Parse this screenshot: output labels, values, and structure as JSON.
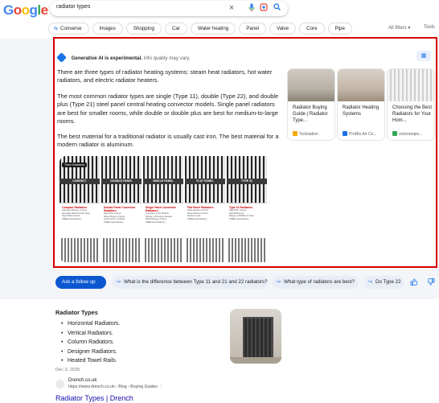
{
  "header": {
    "logo_letters": [
      {
        "ch": "G",
        "color": "#4285F4"
      },
      {
        "ch": "o",
        "color": "#EA4335"
      },
      {
        "ch": "o",
        "color": "#FBBC05"
      },
      {
        "ch": "g",
        "color": "#4285F4"
      },
      {
        "ch": "l",
        "color": "#34A853"
      },
      {
        "ch": "e",
        "color": "#EA4335"
      }
    ],
    "query": "radiator types",
    "icons": [
      "clear-icon",
      "microphone-icon",
      "lens-icon",
      "search-icon"
    ]
  },
  "chips": [
    "Converse",
    "Images",
    "Shopping",
    "Car",
    "Water heating",
    "Panel",
    "Valve",
    "Core",
    "Pipe"
  ],
  "toolbar": {
    "all_filters": "All filters",
    "tools": "Tools"
  },
  "ai_overview": {
    "label_bold": "Generative AI is experimental.",
    "label_note": "Info quality may vary.",
    "paragraphs": [
      "There are three types of radiator heating systems: steam heat radiators, hot water radiators, and electric radiator heaters.",
      "The most common radiator types are single (Type 11), double (Type 22), and double plus (Type 21) steel panel central heating convector models. Single panel radiators are best for smaller rooms, while double or double plus are best for medium-to-large rooms.",
      "The best material for a traditional radiator is usually cast iron. The best material for a modern radiator is aluminum."
    ],
    "infographic": {
      "tag": "Trace Radiators",
      "columns": [
        {
          "band": "COMPACT",
          "title": "Compact Radiators",
          "lines": [
            "Stainless Range of Sizes",
            "Strongest Bend Profile Style",
            "Steel White Finish",
            "FREE Fast Delivery"
          ]
        },
        {
          "band": "DOUBLE PANEL",
          "title": "Double Panel Convector Radiators",
          "lines": [
            "High BTU Output",
            "Wide Range of Sizes",
            "Horizontal or Vertical",
            "FREE Fast Delivery"
          ]
        },
        {
          "band": "SINGLE PANEL",
          "title": "Single Panel Convector Radiators",
          "lines": [
            "Compact on Fit Models",
            "Range of Pressure Models",
            "Wide Range of Sizes",
            "FREE Fast Delivery"
          ]
        },
        {
          "band": "FLAT PANEL",
          "title": "Flat Panel Radiators",
          "lines": [
            "Wide Range of Sizes",
            "Sleek Modern Finish",
            "Modern Look",
            "FREE Fast Delivery"
          ]
        },
        {
          "band": "TYPE 22",
          "title": "Type 22 Radiators",
          "lines": [
            "High BTU Output",
            "High Efficiency",
            "Range of Widths & Sizes",
            "FREE Fast Delivery"
          ]
        }
      ]
    },
    "sources": [
      {
        "title": "Radiator Buying Guide | Radiator Type...",
        "site": "Toolstation",
        "fav": "#f2a900"
      },
      {
        "title": "Radiator Heating Systems",
        "site": "ProRlo Air Co...",
        "fav": "#1a73e8"
      },
      {
        "title": "Choosing the Best Radiators for Your Hom...",
        "site": "victorianplu...",
        "fav": "#34a853"
      }
    ]
  },
  "followups": {
    "ask": "Ask a follow up",
    "suggestions": [
      "What is the difference between Type 11 and 21 and 22 radiators?",
      "What type of radiators are best?",
      "Do Type 22"
    ]
  },
  "result": {
    "title": "Radiator Types",
    "bullets": [
      "Horizontal Radiators.",
      "Vertical Radiators.",
      "Column Radiators.",
      "Designer Radiators.",
      "Heated Towel Rails."
    ],
    "date": "Dec 3, 2020",
    "site_name": "Drench.co.uk",
    "site_url": "https://www.drench.co.uk › Blog › Buying Guides",
    "link": "Radiator Types | Drench"
  }
}
